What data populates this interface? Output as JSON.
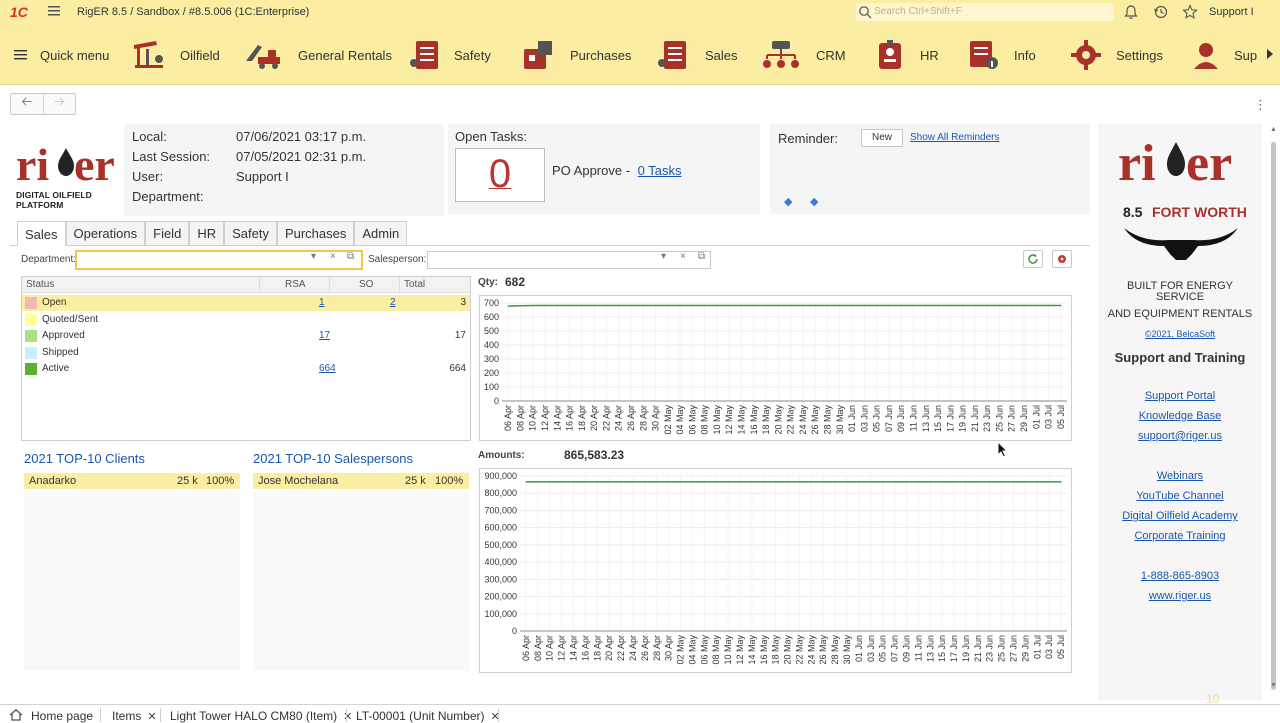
{
  "titlebar": {
    "logo": "1C",
    "title": "RigER 8.5 / Sandbox / #8.5.006  (1C:Enterprise)",
    "search_placeholder": "Search Ctrl+Shift+F",
    "user": "Support I"
  },
  "sections": [
    {
      "label": "Quick menu",
      "icon": "hamburger-icon"
    },
    {
      "label": "Oilfield",
      "icon": "oil-pump-icon"
    },
    {
      "label": "General Rentals",
      "icon": "equipment-icon"
    },
    {
      "label": "Safety",
      "icon": "checklist-icon"
    },
    {
      "label": "Purchases",
      "icon": "purchase-icon"
    },
    {
      "label": "Sales",
      "icon": "sales-icon"
    },
    {
      "label": "CRM",
      "icon": "crm-icon"
    },
    {
      "label": "HR",
      "icon": "badge-icon"
    },
    {
      "label": "Info",
      "icon": "info-doc-icon"
    },
    {
      "label": "Settings",
      "icon": "gear-icon"
    },
    {
      "label": "Sup",
      "icon": "support-icon"
    }
  ],
  "colors": {
    "accent": "#fbeda2",
    "brand_red": "#a8322a",
    "link": "#1a56b0",
    "series": "#3a9a3a"
  },
  "logo": {
    "name": "riger",
    "tagline": "DIGITAL OILFIELD PLATFORM"
  },
  "info": {
    "local_label": "Local:",
    "local_value": "07/06/2021 03:17 p.m.",
    "session_label": "Last Session:",
    "session_value": "07/05/2021 02:31 p.m.",
    "user_label": "User:",
    "user_value": "Support I",
    "department_label": "Department:",
    "department_value": ""
  },
  "tasks": {
    "title": "Open Tasks:",
    "count": "0",
    "po_label": "PO Approve -",
    "po_link": "0 Tasks"
  },
  "reminder": {
    "title": "Reminder:",
    "new_label": "New",
    "show_all": "Show All Reminders"
  },
  "tabs": [
    "Sales",
    "Operations",
    "Field",
    "HR",
    "Safety",
    "Purchases",
    "Admin"
  ],
  "filters": {
    "department_label": "Department:",
    "department_value": "",
    "salesperson_label": "Salesperson:",
    "salesperson_value": ""
  },
  "status_table": {
    "headers": [
      "Status",
      "RSA",
      "SO",
      "Total"
    ],
    "rows": [
      {
        "status": "Open",
        "rsa": "1",
        "so": "2",
        "total": "3",
        "color": "#f5b7b1",
        "highlight": true
      },
      {
        "status": "Quoted/Sent",
        "rsa": "",
        "so": "",
        "total": "",
        "color": "#fdfd9e",
        "highlight": false
      },
      {
        "status": "Approved",
        "rsa": "17",
        "so": "",
        "total": "17",
        "color": "#a7e07f",
        "highlight": false
      },
      {
        "status": "Shipped",
        "rsa": "",
        "so": "",
        "total": "",
        "color": "#c8eef8",
        "highlight": false
      },
      {
        "status": "Active",
        "rsa": "664",
        "so": "",
        "total": "664",
        "color": "#5cae2c",
        "highlight": false
      }
    ]
  },
  "top_clients": {
    "title": "2021 TOP-10 Clients",
    "rows": [
      {
        "name": "Anadarko",
        "amount": "25 k",
        "pct": "100%"
      }
    ]
  },
  "top_salespersons": {
    "title": "2021 TOP-10 Salespersons",
    "rows": [
      {
        "name": "Jose Mochelana",
        "amount": "25 k",
        "pct": "100%"
      }
    ]
  },
  "chart_data": [
    {
      "type": "line",
      "label": "Qty:",
      "total": "682",
      "x": [
        "06 Apr",
        "08 Apr",
        "10 Apr",
        "12 Apr",
        "14 Apr",
        "16 Apr",
        "18 Apr",
        "20 Apr",
        "22 Apr",
        "24 Apr",
        "26 Apr",
        "28 Apr",
        "30 Apr",
        "02 May",
        "04 May",
        "06 May",
        "08 May",
        "10 May",
        "12 May",
        "14 May",
        "16 May",
        "18 May",
        "20 May",
        "22 May",
        "24 May",
        "26 May",
        "28 May",
        "30 May",
        "01 Jun",
        "03 Jun",
        "05 Jun",
        "07 Jun",
        "09 Jun",
        "11 Jun",
        "13 Jun",
        "15 Jun",
        "17 Jun",
        "19 Jun",
        "21 Jun",
        "23 Jun",
        "25 Jun",
        "27 Jun",
        "29 Jun",
        "01 Jul",
        "03 Jul",
        "05 Jul"
      ],
      "y_ticks": [
        "700",
        "600",
        "500",
        "400",
        "300",
        "200",
        "100",
        "0"
      ],
      "ylim": [
        0,
        700
      ],
      "series": [
        {
          "values": [
            678,
            680,
            682,
            682,
            682,
            682,
            682,
            682,
            682,
            682,
            682,
            682,
            682,
            682,
            682,
            682,
            682,
            682,
            682,
            682,
            682,
            682,
            682,
            682,
            682,
            682,
            682,
            682,
            682,
            682,
            682,
            682,
            682,
            682,
            682,
            682,
            682,
            682,
            682,
            682,
            682,
            682,
            682,
            682,
            682,
            682
          ]
        }
      ]
    },
    {
      "type": "line",
      "label": "Amounts:",
      "total": "865,583.23",
      "x": [
        "06 Apr",
        "08 Apr",
        "10 Apr",
        "12 Apr",
        "14 Apr",
        "16 Apr",
        "18 Apr",
        "20 Apr",
        "22 Apr",
        "24 Apr",
        "26 Apr",
        "28 Apr",
        "30 Apr",
        "02 May",
        "04 May",
        "06 May",
        "08 May",
        "10 May",
        "12 May",
        "14 May",
        "16 May",
        "18 May",
        "20 May",
        "22 May",
        "24 May",
        "26 May",
        "28 May",
        "30 May",
        "01 Jun",
        "03 Jun",
        "05 Jun",
        "07 Jun",
        "09 Jun",
        "11 Jun",
        "13 Jun",
        "15 Jun",
        "17 Jun",
        "19 Jun",
        "21 Jun",
        "23 Jun",
        "25 Jun",
        "27 Jun",
        "29 Jun",
        "01 Jul",
        "03 Jul",
        "05 Jul"
      ],
      "y_ticks": [
        "900,000",
        "800,000",
        "700,000",
        "600,000",
        "500,000",
        "400,000",
        "300,000",
        "200,000",
        "100,000",
        "0"
      ],
      "ylim": [
        0,
        900000
      ],
      "series": [
        {
          "values": [
            865583,
            865583,
            865583,
            865583,
            865583,
            865583,
            865583,
            865583,
            865583,
            865583,
            865583,
            865583,
            865583,
            865583,
            865583,
            865583,
            865583,
            865583,
            865583,
            865583,
            865583,
            865583,
            865583,
            865583,
            865583,
            865583,
            865583,
            865583,
            865583,
            865583,
            865583,
            865583,
            865583,
            865583,
            865583,
            865583,
            865583,
            865583,
            865583,
            865583,
            865583,
            865583,
            865583,
            865583,
            865583,
            865583
          ]
        }
      ]
    }
  ],
  "right_panel": {
    "brand": "riger",
    "version": "8.5",
    "city": "FORT WORTH",
    "built1": "BUILT FOR ENERGY",
    "built2": "SERVICE",
    "built3": "AND EQUIPMENT RENTALS",
    "copyright": "©2021, BelcaSoft",
    "heading": "Support and Training",
    "links1": [
      "Support Portal",
      "Knowledge Base",
      "support@riger.us"
    ],
    "links2": [
      "Webinars",
      "YouTube Channel",
      "Digital Oilfield Academy",
      "Corporate Training"
    ],
    "phone": "1-888-865-8903",
    "site": "www.riger.us",
    "corner_num": "10"
  },
  "bottom_tabs": [
    {
      "label": "Home page",
      "closable": false
    },
    {
      "label": "Items",
      "closable": true
    },
    {
      "label": "Light Tower HALO CM80 (Item)",
      "closable": true
    },
    {
      "label": "LT-00001 (Unit Number)",
      "closable": true
    }
  ]
}
